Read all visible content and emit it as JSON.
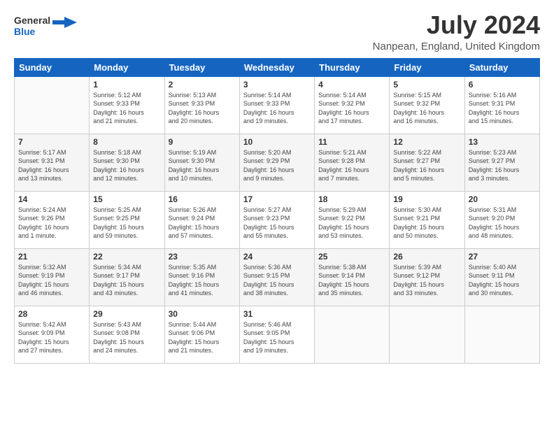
{
  "logo": {
    "line1": "General",
    "line2": "Blue"
  },
  "title": "July 2024",
  "subtitle": "Nanpean, England, United Kingdom",
  "weekdays": [
    "Sunday",
    "Monday",
    "Tuesday",
    "Wednesday",
    "Thursday",
    "Friday",
    "Saturday"
  ],
  "weeks": [
    [
      {
        "day": "",
        "info": ""
      },
      {
        "day": "1",
        "info": "Sunrise: 5:12 AM\nSunset: 9:33 PM\nDaylight: 16 hours\nand 21 minutes."
      },
      {
        "day": "2",
        "info": "Sunrise: 5:13 AM\nSunset: 9:33 PM\nDaylight: 16 hours\nand 20 minutes."
      },
      {
        "day": "3",
        "info": "Sunrise: 5:14 AM\nSunset: 9:33 PM\nDaylight: 16 hours\nand 19 minutes."
      },
      {
        "day": "4",
        "info": "Sunrise: 5:14 AM\nSunset: 9:32 PM\nDaylight: 16 hours\nand 17 minutes."
      },
      {
        "day": "5",
        "info": "Sunrise: 5:15 AM\nSunset: 9:32 PM\nDaylight: 16 hours\nand 16 minutes."
      },
      {
        "day": "6",
        "info": "Sunrise: 5:16 AM\nSunset: 9:31 PM\nDaylight: 16 hours\nand 15 minutes."
      }
    ],
    [
      {
        "day": "7",
        "info": "Sunrise: 5:17 AM\nSunset: 9:31 PM\nDaylight: 16 hours\nand 13 minutes."
      },
      {
        "day": "8",
        "info": "Sunrise: 5:18 AM\nSunset: 9:30 PM\nDaylight: 16 hours\nand 12 minutes."
      },
      {
        "day": "9",
        "info": "Sunrise: 5:19 AM\nSunset: 9:30 PM\nDaylight: 16 hours\nand 10 minutes."
      },
      {
        "day": "10",
        "info": "Sunrise: 5:20 AM\nSunset: 9:29 PM\nDaylight: 16 hours\nand 9 minutes."
      },
      {
        "day": "11",
        "info": "Sunrise: 5:21 AM\nSunset: 9:28 PM\nDaylight: 16 hours\nand 7 minutes."
      },
      {
        "day": "12",
        "info": "Sunrise: 5:22 AM\nSunset: 9:27 PM\nDaylight: 16 hours\nand 5 minutes."
      },
      {
        "day": "13",
        "info": "Sunrise: 5:23 AM\nSunset: 9:27 PM\nDaylight: 16 hours\nand 3 minutes."
      }
    ],
    [
      {
        "day": "14",
        "info": "Sunrise: 5:24 AM\nSunset: 9:26 PM\nDaylight: 16 hours\nand 1 minute."
      },
      {
        "day": "15",
        "info": "Sunrise: 5:25 AM\nSunset: 9:25 PM\nDaylight: 15 hours\nand 59 minutes."
      },
      {
        "day": "16",
        "info": "Sunrise: 5:26 AM\nSunset: 9:24 PM\nDaylight: 15 hours\nand 57 minutes."
      },
      {
        "day": "17",
        "info": "Sunrise: 5:27 AM\nSunset: 9:23 PM\nDaylight: 15 hours\nand 55 minutes."
      },
      {
        "day": "18",
        "info": "Sunrise: 5:29 AM\nSunset: 9:22 PM\nDaylight: 15 hours\nand 53 minutes."
      },
      {
        "day": "19",
        "info": "Sunrise: 5:30 AM\nSunset: 9:21 PM\nDaylight: 15 hours\nand 50 minutes."
      },
      {
        "day": "20",
        "info": "Sunrise: 5:31 AM\nSunset: 9:20 PM\nDaylight: 15 hours\nand 48 minutes."
      }
    ],
    [
      {
        "day": "21",
        "info": "Sunrise: 5:32 AM\nSunset: 9:19 PM\nDaylight: 15 hours\nand 46 minutes."
      },
      {
        "day": "22",
        "info": "Sunrise: 5:34 AM\nSunset: 9:17 PM\nDaylight: 15 hours\nand 43 minutes."
      },
      {
        "day": "23",
        "info": "Sunrise: 5:35 AM\nSunset: 9:16 PM\nDaylight: 15 hours\nand 41 minutes."
      },
      {
        "day": "24",
        "info": "Sunrise: 5:36 AM\nSunset: 9:15 PM\nDaylight: 15 hours\nand 38 minutes."
      },
      {
        "day": "25",
        "info": "Sunrise: 5:38 AM\nSunset: 9:14 PM\nDaylight: 15 hours\nand 35 minutes."
      },
      {
        "day": "26",
        "info": "Sunrise: 5:39 AM\nSunset: 9:12 PM\nDaylight: 15 hours\nand 33 minutes."
      },
      {
        "day": "27",
        "info": "Sunrise: 5:40 AM\nSunset: 9:11 PM\nDaylight: 15 hours\nand 30 minutes."
      }
    ],
    [
      {
        "day": "28",
        "info": "Sunrise: 5:42 AM\nSunset: 9:09 PM\nDaylight: 15 hours\nand 27 minutes."
      },
      {
        "day": "29",
        "info": "Sunrise: 5:43 AM\nSunset: 9:08 PM\nDaylight: 15 hours\nand 24 minutes."
      },
      {
        "day": "30",
        "info": "Sunrise: 5:44 AM\nSunset: 9:06 PM\nDaylight: 15 hours\nand 21 minutes."
      },
      {
        "day": "31",
        "info": "Sunrise: 5:46 AM\nSunset: 9:05 PM\nDaylight: 15 hours\nand 19 minutes."
      },
      {
        "day": "",
        "info": ""
      },
      {
        "day": "",
        "info": ""
      },
      {
        "day": "",
        "info": ""
      }
    ]
  ]
}
